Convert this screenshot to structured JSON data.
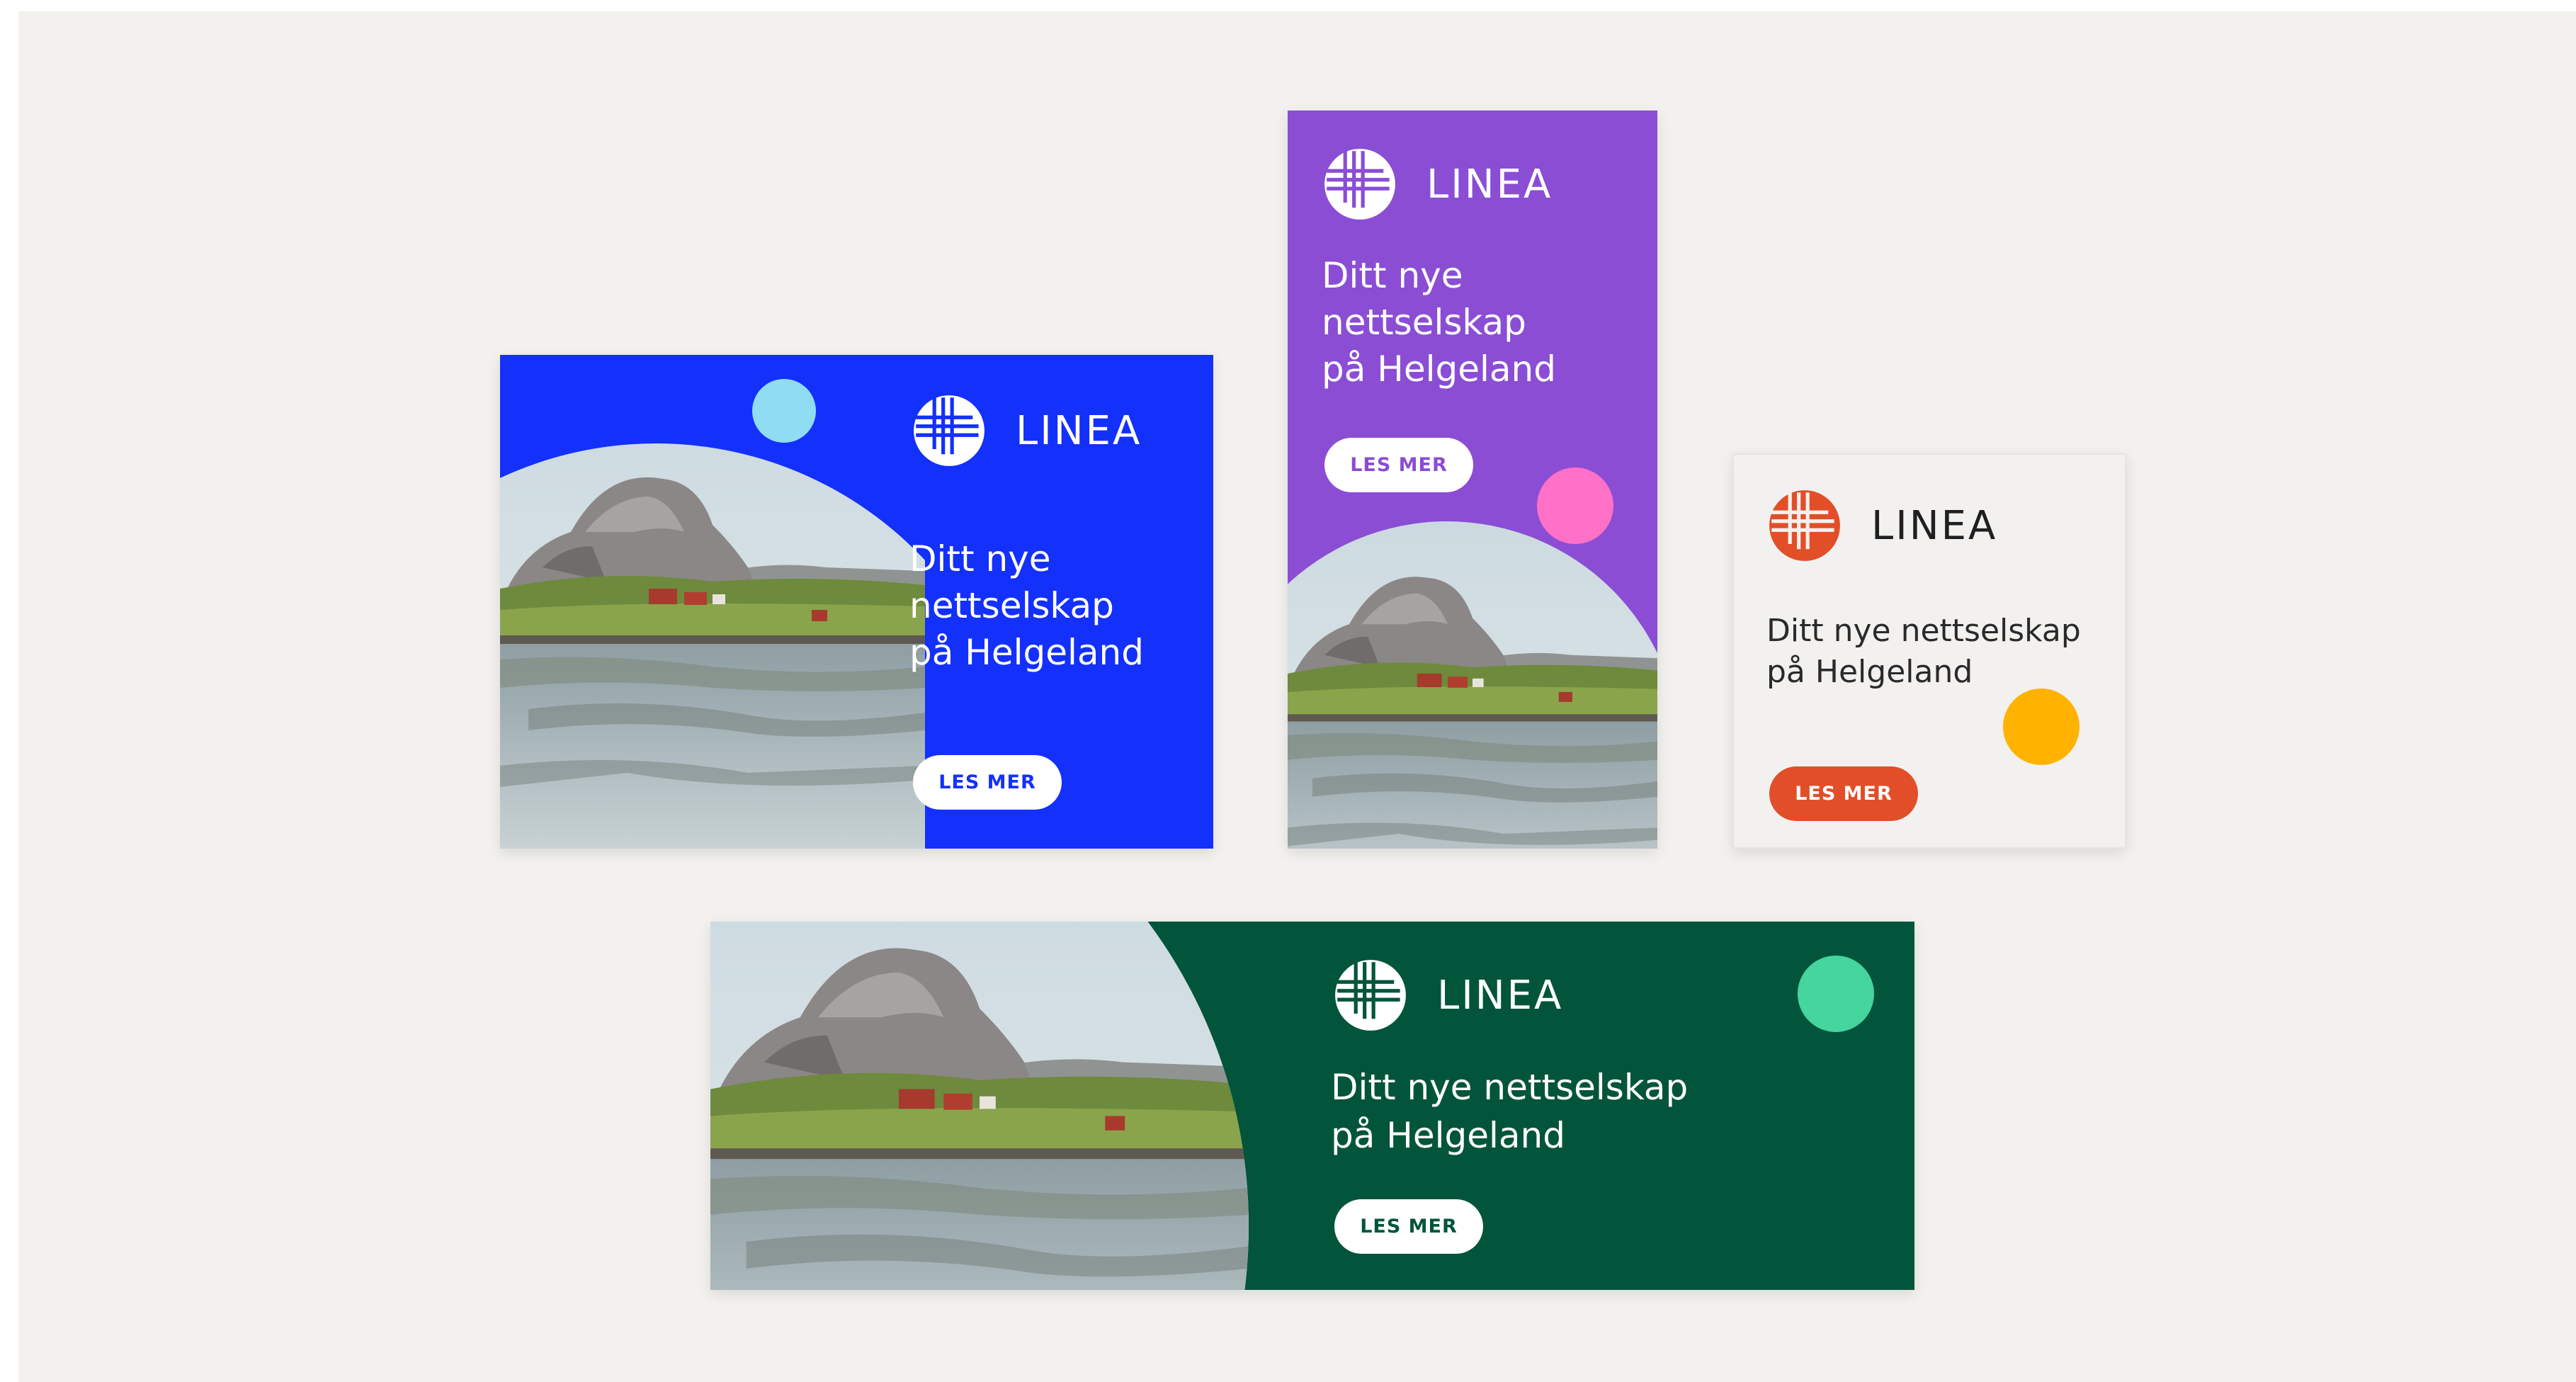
{
  "brand": {
    "name": "LINEA"
  },
  "headline": {
    "line1": "Ditt nye",
    "line2": "nettselskap",
    "line3": "på Helgeland",
    "wide_line1": "Ditt nye nettselskap"
  },
  "cta": {
    "label": "LES MER"
  },
  "colors": {
    "background": "#f3f1ee",
    "blue": "#1430fb",
    "purple": "#8a4dd4",
    "light": "#f2f1ef",
    "green": "#02553a",
    "accent_lightblue": "#8fdcf3",
    "accent_pink": "#ff70c7",
    "accent_yellow": "#ffb300",
    "accent_mint": "#45d59e",
    "orange": "#e24e27"
  },
  "icons": {
    "logo": "linea-globe-icon"
  }
}
